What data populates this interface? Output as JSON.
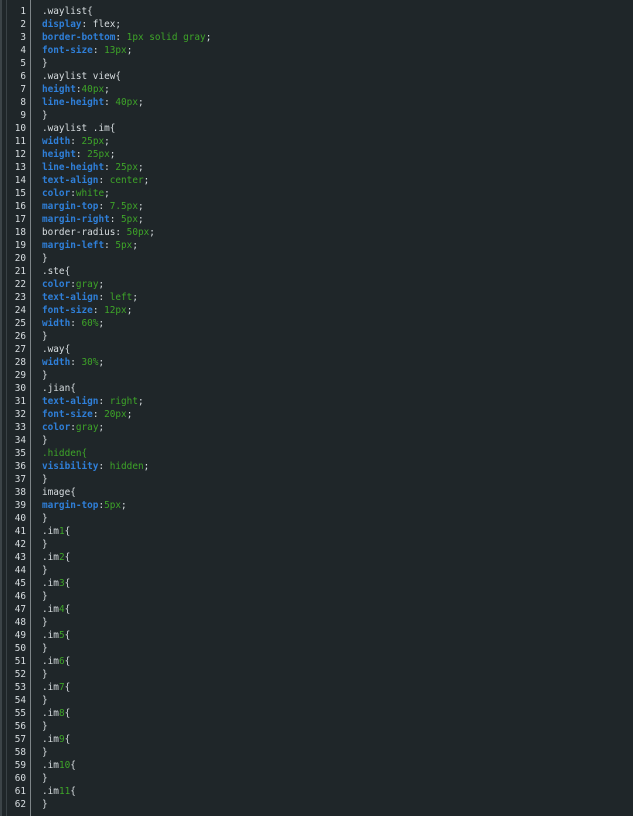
{
  "editor": {
    "lines": [
      [
        {
          "t": ".waylist{",
          "c": "sel"
        }
      ],
      [
        {
          "t": "display",
          "c": "prop"
        },
        {
          "t": ": flex;",
          "c": "sel"
        }
      ],
      [
        {
          "t": "border-bottom",
          "c": "prop"
        },
        {
          "t": ": ",
          "c": "sel"
        },
        {
          "t": "1px solid gray",
          "c": "val"
        },
        {
          "t": ";",
          "c": "sel"
        }
      ],
      [
        {
          "t": "font-size",
          "c": "prop"
        },
        {
          "t": ": ",
          "c": "sel"
        },
        {
          "t": "13px",
          "c": "val"
        },
        {
          "t": ";",
          "c": "sel"
        }
      ],
      [
        {
          "t": "}",
          "c": "sel"
        }
      ],
      [
        {
          "t": ".waylist view{",
          "c": "sel"
        }
      ],
      [
        {
          "t": "height",
          "c": "prop"
        },
        {
          "t": ":",
          "c": "sel"
        },
        {
          "t": "40px",
          "c": "val"
        },
        {
          "t": ";",
          "c": "sel"
        }
      ],
      [
        {
          "t": "line-height",
          "c": "prop"
        },
        {
          "t": ": ",
          "c": "sel"
        },
        {
          "t": "40px",
          "c": "val"
        },
        {
          "t": ";",
          "c": "sel"
        }
      ],
      [
        {
          "t": "}",
          "c": "sel"
        }
      ],
      [
        {
          "t": ".waylist .im{",
          "c": "sel"
        }
      ],
      [
        {
          "t": "width",
          "c": "prop"
        },
        {
          "t": ": ",
          "c": "sel"
        },
        {
          "t": "25px",
          "c": "val"
        },
        {
          "t": ";",
          "c": "sel"
        }
      ],
      [
        {
          "t": "height",
          "c": "prop"
        },
        {
          "t": ": ",
          "c": "sel"
        },
        {
          "t": "25px",
          "c": "val"
        },
        {
          "t": ";",
          "c": "sel"
        }
      ],
      [
        {
          "t": "line-height",
          "c": "prop"
        },
        {
          "t": ": ",
          "c": "sel"
        },
        {
          "t": "25px",
          "c": "val"
        },
        {
          "t": ";",
          "c": "sel"
        }
      ],
      [
        {
          "t": "text-align",
          "c": "prop"
        },
        {
          "t": ": ",
          "c": "sel"
        },
        {
          "t": "center",
          "c": "val"
        },
        {
          "t": ";",
          "c": "sel"
        }
      ],
      [
        {
          "t": "color",
          "c": "prop"
        },
        {
          "t": ":",
          "c": "sel"
        },
        {
          "t": "white",
          "c": "val"
        },
        {
          "t": ";",
          "c": "sel"
        }
      ],
      [
        {
          "t": "margin-top",
          "c": "prop"
        },
        {
          "t": ": ",
          "c": "sel"
        },
        {
          "t": "7.5px",
          "c": "val"
        },
        {
          "t": ";",
          "c": "sel"
        }
      ],
      [
        {
          "t": "margin-right",
          "c": "prop"
        },
        {
          "t": ": ",
          "c": "sel"
        },
        {
          "t": "5px",
          "c": "val"
        },
        {
          "t": ";",
          "c": "sel"
        }
      ],
      [
        {
          "t": "border-radius: ",
          "c": "sel"
        },
        {
          "t": "50px",
          "c": "val"
        },
        {
          "t": ";",
          "c": "sel"
        }
      ],
      [
        {
          "t": "margin-left",
          "c": "prop"
        },
        {
          "t": ": ",
          "c": "sel"
        },
        {
          "t": "5px",
          "c": "val"
        },
        {
          "t": ";",
          "c": "sel"
        }
      ],
      [
        {
          "t": "}",
          "c": "sel"
        }
      ],
      [
        {
          "t": ".ste{",
          "c": "sel"
        }
      ],
      [
        {
          "t": "color",
          "c": "prop"
        },
        {
          "t": ":",
          "c": "sel"
        },
        {
          "t": "gray",
          "c": "val"
        },
        {
          "t": ";",
          "c": "sel"
        }
      ],
      [
        {
          "t": "text-align",
          "c": "prop"
        },
        {
          "t": ": ",
          "c": "sel"
        },
        {
          "t": "left",
          "c": "val"
        },
        {
          "t": ";",
          "c": "sel"
        }
      ],
      [
        {
          "t": "font-size",
          "c": "prop"
        },
        {
          "t": ": ",
          "c": "sel"
        },
        {
          "t": "12px",
          "c": "val"
        },
        {
          "t": ";",
          "c": "sel"
        }
      ],
      [
        {
          "t": "width",
          "c": "prop"
        },
        {
          "t": ": ",
          "c": "sel"
        },
        {
          "t": "60%",
          "c": "val"
        },
        {
          "t": ";",
          "c": "sel"
        }
      ],
      [
        {
          "t": "}",
          "c": "sel"
        }
      ],
      [
        {
          "t": ".way{",
          "c": "sel"
        }
      ],
      [
        {
          "t": "width",
          "c": "prop"
        },
        {
          "t": ": ",
          "c": "sel"
        },
        {
          "t": "30%",
          "c": "val"
        },
        {
          "t": ";",
          "c": "sel"
        }
      ],
      [
        {
          "t": "}",
          "c": "sel"
        }
      ],
      [
        {
          "t": ".jian{",
          "c": "sel"
        }
      ],
      [
        {
          "t": "text-align",
          "c": "prop"
        },
        {
          "t": ": ",
          "c": "sel"
        },
        {
          "t": "right",
          "c": "val"
        },
        {
          "t": ";",
          "c": "sel"
        }
      ],
      [
        {
          "t": "font-size",
          "c": "prop"
        },
        {
          "t": ": ",
          "c": "sel"
        },
        {
          "t": "20px",
          "c": "val"
        },
        {
          "t": ";",
          "c": "sel"
        }
      ],
      [
        {
          "t": "color",
          "c": "prop"
        },
        {
          "t": ":",
          "c": "sel"
        },
        {
          "t": "gray",
          "c": "val"
        },
        {
          "t": ";",
          "c": "sel"
        }
      ],
      [
        {
          "t": "}",
          "c": "sel"
        }
      ],
      [
        {
          "t": ".hidden{",
          "c": "val"
        }
      ],
      [
        {
          "t": "visibility",
          "c": "prop"
        },
        {
          "t": ": ",
          "c": "sel"
        },
        {
          "t": "hidden",
          "c": "val"
        },
        {
          "t": ";",
          "c": "sel"
        }
      ],
      [
        {
          "t": "}",
          "c": "sel"
        }
      ],
      [
        {
          "t": "image{",
          "c": "sel"
        }
      ],
      [
        {
          "t": "margin-top",
          "c": "prop"
        },
        {
          "t": ":",
          "c": "sel"
        },
        {
          "t": "5px",
          "c": "val"
        },
        {
          "t": ";",
          "c": "sel"
        }
      ],
      [
        {
          "t": "}",
          "c": "sel"
        }
      ],
      [
        {
          "t": ".im",
          "c": "sel"
        },
        {
          "t": "1",
          "c": "num"
        },
        {
          "t": "{",
          "c": "sel"
        }
      ],
      [
        {
          "t": "}",
          "c": "sel"
        }
      ],
      [
        {
          "t": ".im",
          "c": "sel"
        },
        {
          "t": "2",
          "c": "num"
        },
        {
          "t": "{",
          "c": "sel"
        }
      ],
      [
        {
          "t": "}",
          "c": "sel"
        }
      ],
      [
        {
          "t": ".im",
          "c": "sel"
        },
        {
          "t": "3",
          "c": "num"
        },
        {
          "t": "{",
          "c": "sel"
        }
      ],
      [
        {
          "t": "}",
          "c": "sel"
        }
      ],
      [
        {
          "t": ".im",
          "c": "sel"
        },
        {
          "t": "4",
          "c": "num"
        },
        {
          "t": "{",
          "c": "sel"
        }
      ],
      [
        {
          "t": "}",
          "c": "sel"
        }
      ],
      [
        {
          "t": ".im",
          "c": "sel"
        },
        {
          "t": "5",
          "c": "num"
        },
        {
          "t": "{",
          "c": "sel"
        }
      ],
      [
        {
          "t": "}",
          "c": "sel"
        }
      ],
      [
        {
          "t": ".im",
          "c": "sel"
        },
        {
          "t": "6",
          "c": "num"
        },
        {
          "t": "{",
          "c": "sel"
        }
      ],
      [
        {
          "t": "}",
          "c": "sel"
        }
      ],
      [
        {
          "t": ".im",
          "c": "sel"
        },
        {
          "t": "7",
          "c": "num"
        },
        {
          "t": "{",
          "c": "sel"
        }
      ],
      [
        {
          "t": "}",
          "c": "sel"
        }
      ],
      [
        {
          "t": ".im",
          "c": "sel"
        },
        {
          "t": "8",
          "c": "num"
        },
        {
          "t": "{",
          "c": "sel"
        }
      ],
      [
        {
          "t": "}",
          "c": "sel"
        }
      ],
      [
        {
          "t": ".im",
          "c": "sel"
        },
        {
          "t": "9",
          "c": "num"
        },
        {
          "t": "{",
          "c": "sel"
        }
      ],
      [
        {
          "t": "}",
          "c": "sel"
        }
      ],
      [
        {
          "t": ".im",
          "c": "sel"
        },
        {
          "t": "10",
          "c": "num"
        },
        {
          "t": "{",
          "c": "sel"
        }
      ],
      [
        {
          "t": "}",
          "c": "sel"
        }
      ],
      [
        {
          "t": ".im",
          "c": "sel"
        },
        {
          "t": "11",
          "c": "num"
        },
        {
          "t": "{",
          "c": "sel"
        }
      ],
      [
        {
          "t": "}",
          "c": "sel"
        }
      ]
    ]
  },
  "colors": {
    "background": "#1f2629",
    "property": "#2f7fd8",
    "value": "#3ea529",
    "text": "#d7dde0"
  }
}
